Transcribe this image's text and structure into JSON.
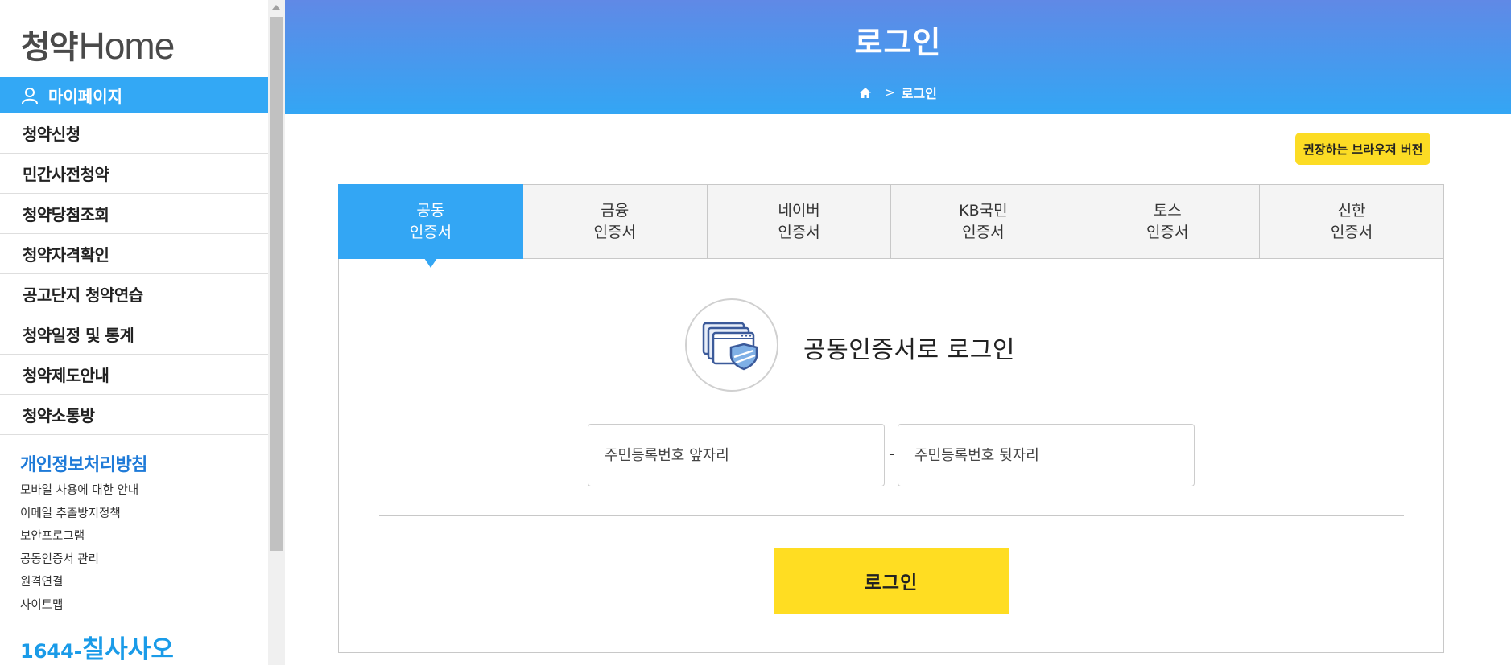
{
  "sidebar": {
    "logo_kr": "청약",
    "logo_en": "Home",
    "mypage_label": "마이페이지",
    "menu": [
      "청약신청",
      "민간사전청약",
      "청약당첨조회",
      "청약자격확인",
      "공고단지 청약연습",
      "청약일정 및 통계",
      "청약제도안내",
      "청약소통방"
    ],
    "policy_title": "개인정보처리방침",
    "sublinks": [
      "모바일 사용에 대한 안내",
      "이메일 추출방지정책",
      "보안프로그램",
      "공동인증서 관리",
      "원격연결",
      "사이트맵"
    ],
    "phone_number": "1644-",
    "phone_text": "칠사사오"
  },
  "header": {
    "title": "로그인",
    "breadcrumb_current": "로그인"
  },
  "browser_badge": "권장하는 브라우저 버전",
  "tabs": [
    {
      "line1": "공동",
      "line2": "인증서"
    },
    {
      "line1": "금융",
      "line2": "인증서"
    },
    {
      "line1": "네이버",
      "line2": "인증서"
    },
    {
      "line1": "KB국민",
      "line2": "인증서"
    },
    {
      "line1": "토스",
      "line2": "인증서"
    },
    {
      "line1": "신한",
      "line2": "인증서"
    }
  ],
  "active_tab": 0,
  "login_panel": {
    "heading": "공동인증서로 로그인",
    "rrn_front_placeholder": "주민등록번호 앞자리",
    "rrn_back_placeholder": "주민등록번호 뒷자리",
    "separator": "-",
    "login_button": "로그인"
  },
  "icons": {
    "user": "user-icon",
    "home": "home-icon",
    "certificate": "certificate-shield-icon"
  },
  "colors": {
    "accent_blue": "#33a6f4",
    "banner_top": "#6089e6",
    "button_yellow": "#ffdd22",
    "policy_blue": "#1e7ad8"
  }
}
